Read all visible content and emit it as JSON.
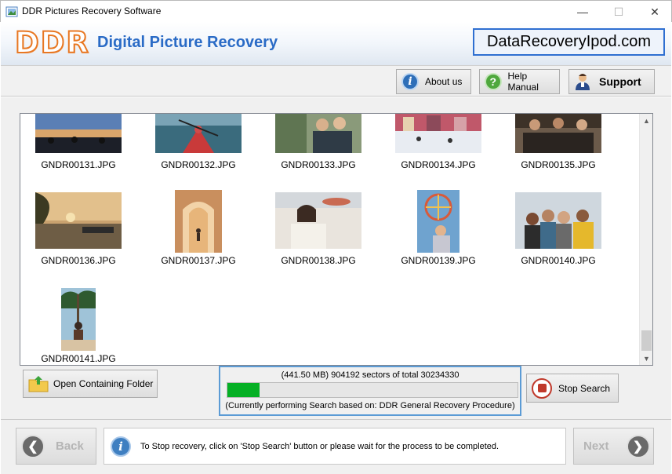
{
  "window": {
    "title": "DDR Pictures Recovery Software",
    "controls": {
      "minimize": "—",
      "maximize": "☐",
      "close": "✕"
    }
  },
  "banner": {
    "logo": "DDR",
    "subtitle": "Digital Picture Recovery",
    "website": "DataRecoveryIpod.com"
  },
  "toolbar": {
    "about": "About us",
    "help": "Help Manual",
    "support": "Support"
  },
  "gallery": {
    "items": [
      {
        "label": "GNDR00131.JPG"
      },
      {
        "label": "GNDR00132.JPG"
      },
      {
        "label": "GNDR00133.JPG"
      },
      {
        "label": "GNDR00134.JPG"
      },
      {
        "label": "GNDR00135.JPG"
      },
      {
        "label": "GNDR00136.JPG"
      },
      {
        "label": "GNDR00137.JPG"
      },
      {
        "label": "GNDR00138.JPG"
      },
      {
        "label": "GNDR00139.JPG"
      },
      {
        "label": "GNDR00140.JPG"
      },
      {
        "label": "GNDR00141.JPG"
      }
    ]
  },
  "actions": {
    "open_folder": "Open Containing Folder",
    "stop_search": "Stop Search"
  },
  "progress": {
    "status": "(441.50 MB) 904192  sectors  of  total 30234330",
    "fraction": 0.11,
    "procedure": "(Currently performing Search based on:  DDR General Recovery Procedure)"
  },
  "footer": {
    "back": "Back",
    "next": "Next",
    "info": "To Stop recovery, click on 'Stop Search' button or please wait for the process to be completed."
  },
  "colors": {
    "accent_blue": "#2a6bc6",
    "logo_orange": "#e87722",
    "progress_green": "#06b025"
  }
}
